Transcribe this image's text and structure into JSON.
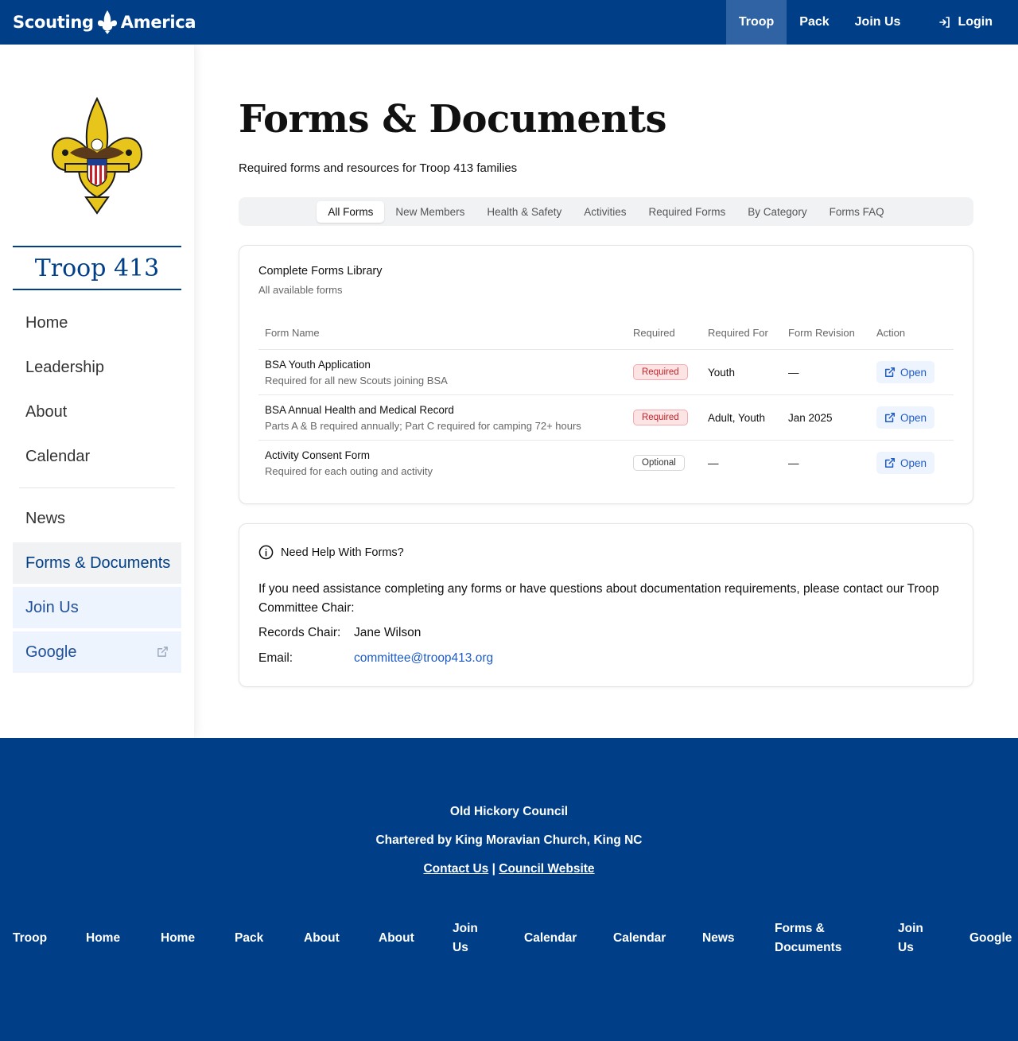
{
  "brand": {
    "name_left": "Scouting",
    "name_right": "America",
    "colors": {
      "primary": "#003f87",
      "active_nav": "#2f63a3",
      "required_badge": "#c0242b",
      "link": "#1e5bc6",
      "gold": "#e8c51a"
    }
  },
  "topnav": {
    "items": [
      {
        "label": "Troop"
      },
      {
        "label": "Pack"
      },
      {
        "label": "Join Us"
      }
    ],
    "login_label": "Login"
  },
  "sidebar": {
    "troop_title": "Troop 413",
    "items": [
      {
        "label": "Home"
      },
      {
        "label": "Leadership"
      },
      {
        "label": "About"
      },
      {
        "label": "Calendar"
      },
      {
        "label": "News"
      },
      {
        "label": "Forms & Documents"
      },
      {
        "label": "Join Us"
      },
      {
        "label": "Google"
      }
    ]
  },
  "main": {
    "title": "Forms & Documents",
    "subtitle": "Required forms and resources for Troop 413 families",
    "tabs": [
      {
        "label": "All Forms"
      },
      {
        "label": "New Members"
      },
      {
        "label": "Health & Safety"
      },
      {
        "label": "Activities"
      },
      {
        "label": "Required Forms"
      },
      {
        "label": "By Category"
      },
      {
        "label": "Forms FAQ"
      }
    ],
    "library": {
      "title": "Complete Forms Library",
      "subtitle": "All available forms",
      "columns": [
        "Form Name",
        "Required",
        "Required For",
        "Form Revision",
        "Action"
      ],
      "rows": [
        {
          "name": "BSA Youth Application",
          "desc": "Required for all new Scouts joining BSA",
          "required": "Required",
          "required_for": "Youth",
          "revision": "—",
          "action": "Open"
        },
        {
          "name": "BSA Annual Health and Medical Record",
          "desc": "Parts A & B required annually; Part C required for camping 72+ hours",
          "required": "Required",
          "required_for": "Adult, Youth",
          "revision": "Jan 2025",
          "action": "Open"
        },
        {
          "name": "Activity Consent Form",
          "desc": "Required for each outing and activity",
          "required": "Optional",
          "required_for": "—",
          "revision": "—",
          "action": "Open"
        }
      ]
    },
    "help": {
      "title": "Need Help With Forms?",
      "text": "If you need assistance completing any forms or have questions about documentation requirements, please contact our Troop Committee Chair:",
      "records_label": "Records Chair:",
      "records_value": "Jane Wilson",
      "email_label": "Email:",
      "email_value": "committee@troop413.org"
    }
  },
  "footer": {
    "council": "Old Hickory Council",
    "chartered": "Chartered by King Moravian Church, King NC",
    "contact_link": "Contact Us",
    "separator": "|",
    "council_link": "Council Website",
    "nav": [
      {
        "label": "Troop"
      },
      {
        "label": "Home"
      },
      {
        "label": "Home"
      },
      {
        "label": "Pack"
      },
      {
        "label": "About"
      },
      {
        "label": "About"
      },
      {
        "label": "Join Us"
      },
      {
        "label": "Calendar"
      },
      {
        "label": "Calendar"
      },
      {
        "label": "News"
      },
      {
        "label": "Forms & Documents"
      },
      {
        "label": "Join Us"
      },
      {
        "label": "Google"
      }
    ]
  }
}
